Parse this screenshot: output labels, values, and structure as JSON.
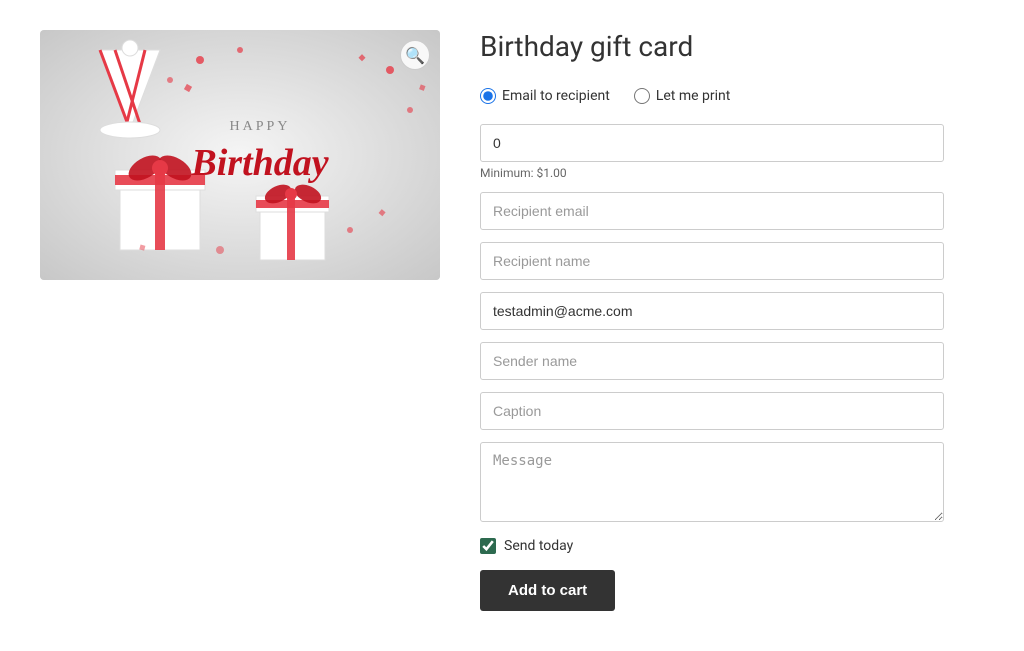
{
  "page": {
    "title": "Birthday gift card"
  },
  "image": {
    "alt": "Birthday gift card image",
    "zoom_label": "🔍"
  },
  "delivery": {
    "option1_label": "Email to recipient",
    "option2_label": "Let me print"
  },
  "form": {
    "amount_value": "0",
    "amount_placeholder": "",
    "amount_min_label": "Minimum: $1.00",
    "recipient_email_placeholder": "Recipient email",
    "recipient_name_placeholder": "Recipient name",
    "sender_email_value": "testadmin@acme.com",
    "sender_name_placeholder": "Sender name",
    "caption_placeholder": "Caption",
    "message_placeholder": "Message",
    "send_today_label": "Send today",
    "send_today_checked": true,
    "add_to_cart_label": "Add to cart"
  }
}
